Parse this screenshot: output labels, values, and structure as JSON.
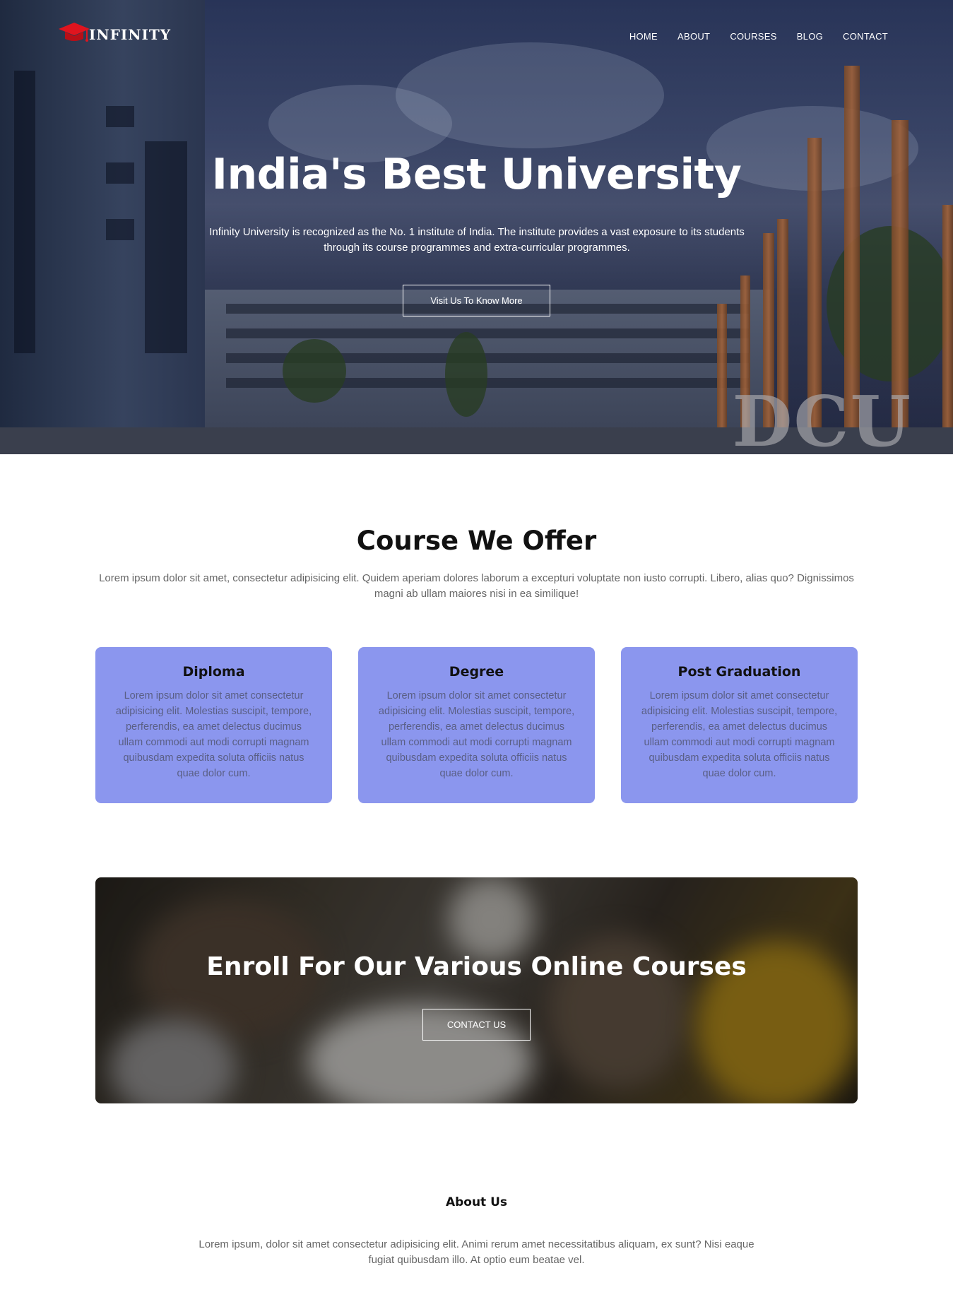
{
  "brand": {
    "name": "INFINITY",
    "logo_icon": "graduation-cap-icon",
    "accent": "#e0141e"
  },
  "nav": {
    "items": [
      "HOME",
      "ABOUT",
      "COURSES",
      "BLOG",
      "CONTACT"
    ]
  },
  "hero": {
    "title": "India's Best University",
    "subtitle": "Infinity University is recognized as the No. 1 institute of India. The institute provides a vast exposure to its students through its course programmes and extra-curricular programmes.",
    "button": "Visit Us To Know More",
    "watermark": "DCU"
  },
  "courses": {
    "title": "Course We Offer",
    "subtitle": "Lorem ipsum dolor sit amet, consectetur adipisicing elit. Quidem aperiam dolores laborum a excepturi voluptate non iusto corrupti. Libero, alias quo? Dignissimos magni ab ullam maiores nisi in ea similique!",
    "card_color": "#8b96ee",
    "cards": [
      {
        "title": "Diploma",
        "text": "Lorem ipsum dolor sit amet consectetur adipisicing elit. Molestias suscipit, tempore, perferendis, ea amet delectus ducimus ullam commodi aut modi corrupti magnam quibusdam expedita soluta officiis natus quae dolor cum."
      },
      {
        "title": "Degree",
        "text": "Lorem ipsum dolor sit amet consectetur adipisicing elit. Molestias suscipit, tempore, perferendis, ea amet delectus ducimus ullam commodi aut modi corrupti magnam quibusdam expedita soluta officiis natus quae dolor cum."
      },
      {
        "title": "Post Graduation",
        "text": "Lorem ipsum dolor sit amet consectetur adipisicing elit. Molestias suscipit, tempore, perferendis, ea amet delectus ducimus ullam commodi aut modi corrupti magnam quibusdam expedita soluta officiis natus quae dolor cum."
      }
    ]
  },
  "enroll": {
    "title": "Enroll For Our Various Online Courses",
    "button": "CONTACT US"
  },
  "about": {
    "title": "About Us",
    "text": "Lorem ipsum, dolor sit amet consectetur adipisicing elit. Animi rerum amet necessitatibus aliquam, ex sunt? Nisi eaque fugiat quibusdam illo. At optio eum beatae vel."
  }
}
